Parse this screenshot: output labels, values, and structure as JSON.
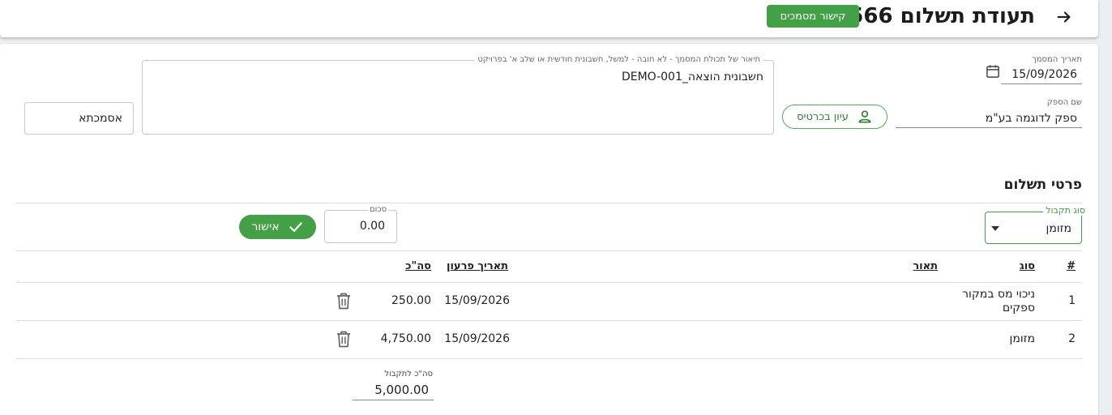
{
  "header": {
    "title": "תעודת תשלום 566",
    "link_docs_label": "קישור מסמכים"
  },
  "form": {
    "doc_date": {
      "label": "תאריך המסמך",
      "value": "15/09/2026"
    },
    "description": {
      "label": "תיאור של תכולת המסמך - לא חובה - למשל, חשבונית חודשית או שלב א' בפרויקט",
      "value": "חשבונית הוצאה_DEMO-001"
    },
    "reference": {
      "value": "אסמכתא"
    },
    "supplier": {
      "label": "שם הספק",
      "value": "ספק לדוגמה בע\"מ"
    },
    "view_cards_label": "עיון בכרטיס"
  },
  "payment": {
    "section_title": "פרטי תשלום",
    "type_label": "סוג תקבול",
    "type_value": "מזומן",
    "amount_label": "סכום",
    "amount_value": "0.00",
    "approve_label": "אישור"
  },
  "table": {
    "headers": {
      "num": "#",
      "type": "סוג",
      "description": "תאור",
      "due_date": "תאריך פרעון",
      "total": "סה\"כ"
    },
    "rows": [
      {
        "num": "1",
        "type_line1": "ניכוי מס במקור",
        "type_line2": "ספקים",
        "description": "",
        "due_date": "15/09/2026",
        "total": "250.00"
      },
      {
        "num": "2",
        "type_line1": "מזומן",
        "type_line2": "",
        "description": "",
        "due_date": "15/09/2026",
        "total": "4,750.00"
      }
    ]
  },
  "summary": {
    "total_label": "סה\"כ לתקבול",
    "total_value": "5,000.00"
  },
  "icons": {
    "back": "arrow-right-icon",
    "calendar": "calendar-icon",
    "person": "person-icon",
    "check": "check-icon",
    "dropdown": "caret-down-icon",
    "delete": "trash-icon"
  },
  "colors": {
    "accent": "#43a047"
  }
}
